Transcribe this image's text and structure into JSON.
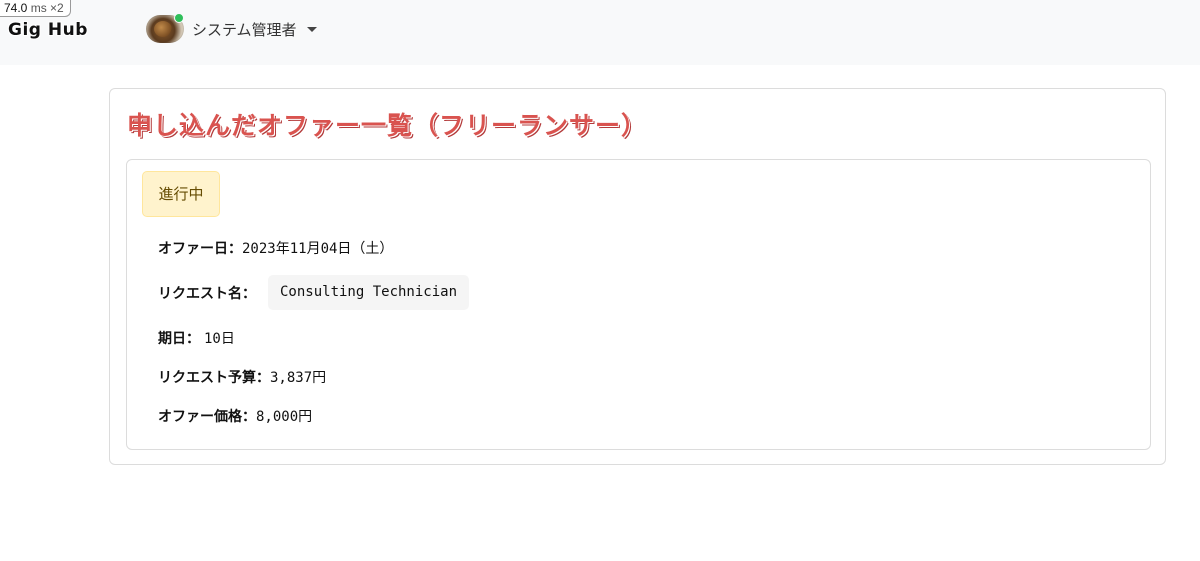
{
  "perf_badge": {
    "value": "74.0",
    "unit": "ms",
    "multiplier": "×2"
  },
  "navbar": {
    "brand": "Gig Hub",
    "user": {
      "avatar_icon": "avatar-image",
      "status_color": "#2fbf5a",
      "name": "システム管理者",
      "dropdown_icon": "caret-down-icon"
    }
  },
  "page": {
    "title": "申し込んだオファー一覧（フリーランサー）",
    "title_color": "#d9534f"
  },
  "offer": {
    "status": "進行中",
    "fields": {
      "offer_date_label": "オファー日：",
      "offer_date_value": "2023年11月04日（土）",
      "request_name_label": "リクエスト名：",
      "request_name_value": "Consulting Technician",
      "deadline_label": "期日：",
      "deadline_value": "10日",
      "request_budget_label": "リクエスト予算：",
      "request_budget_value": "3,837円",
      "offer_price_label": "オファー価格：",
      "offer_price_value": "8,000円"
    }
  }
}
